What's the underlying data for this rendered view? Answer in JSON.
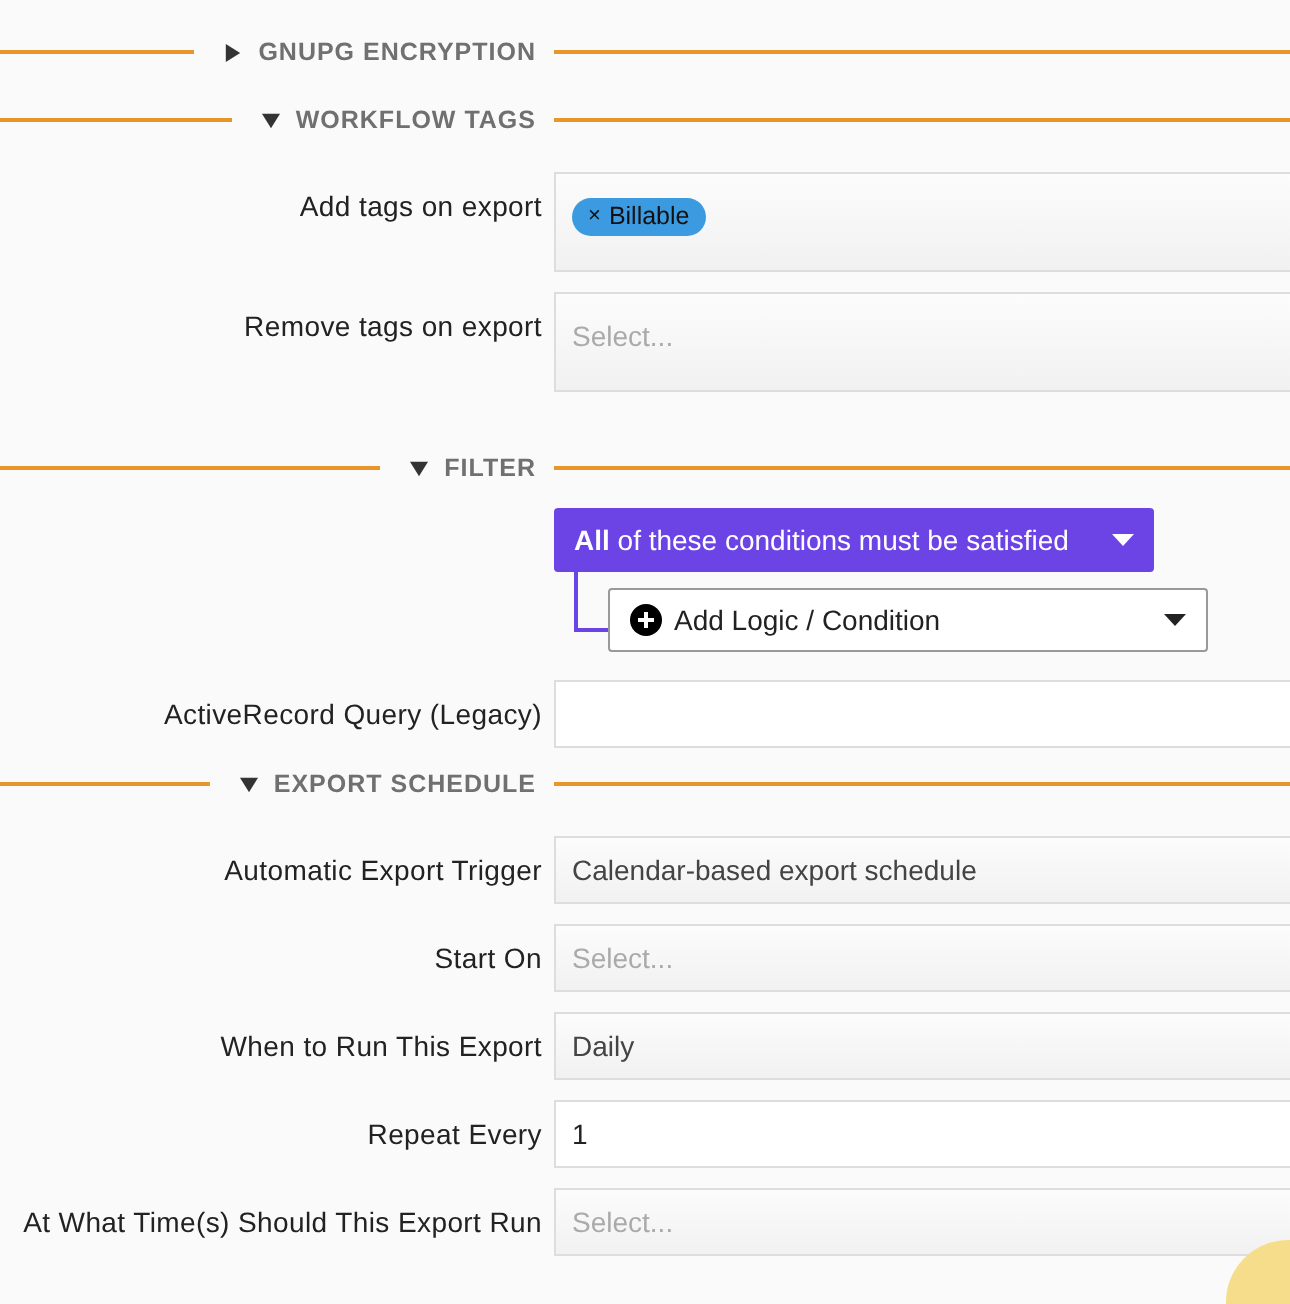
{
  "sections": [
    {
      "title": "GNUPG ENCRYPTION",
      "expanded": false
    },
    {
      "title": "WORKFLOW TAGS",
      "expanded": true,
      "fields": [
        {
          "kind": "tags",
          "label": "Add tags on export",
          "tags": [
            "Billable"
          ],
          "remove_mark": "×"
        },
        {
          "kind": "tags",
          "label": "Remove tags on export",
          "placeholder": "Select..."
        }
      ]
    },
    {
      "title": "FILTER",
      "expanded": true,
      "fields": [
        {
          "kind": "filter",
          "condition": "**All** of these conditions must be satisfied",
          "add": "Add Logic / Condition"
        },
        {
          "kind": "input",
          "label": "ActiveRecord Query (Legacy)"
        }
      ]
    },
    {
      "title": "EXPORT SCHEDULE",
      "expanded": true,
      "fields": [
        {
          "kind": "select",
          "label": "Automatic Export Trigger",
          "value": "Calendar-based export schedule"
        },
        {
          "kind": "select",
          "label": "Start On",
          "placeholder": "Select..."
        },
        {
          "kind": "select",
          "label": "When to Run This Export",
          "value": "Daily"
        },
        {
          "kind": "input",
          "label": "Repeat Every",
          "value": "1"
        },
        {
          "kind": "select",
          "label": "At What Time(s) Should This Export Run",
          "placeholder": "Select..."
        }
      ]
    }
  ]
}
